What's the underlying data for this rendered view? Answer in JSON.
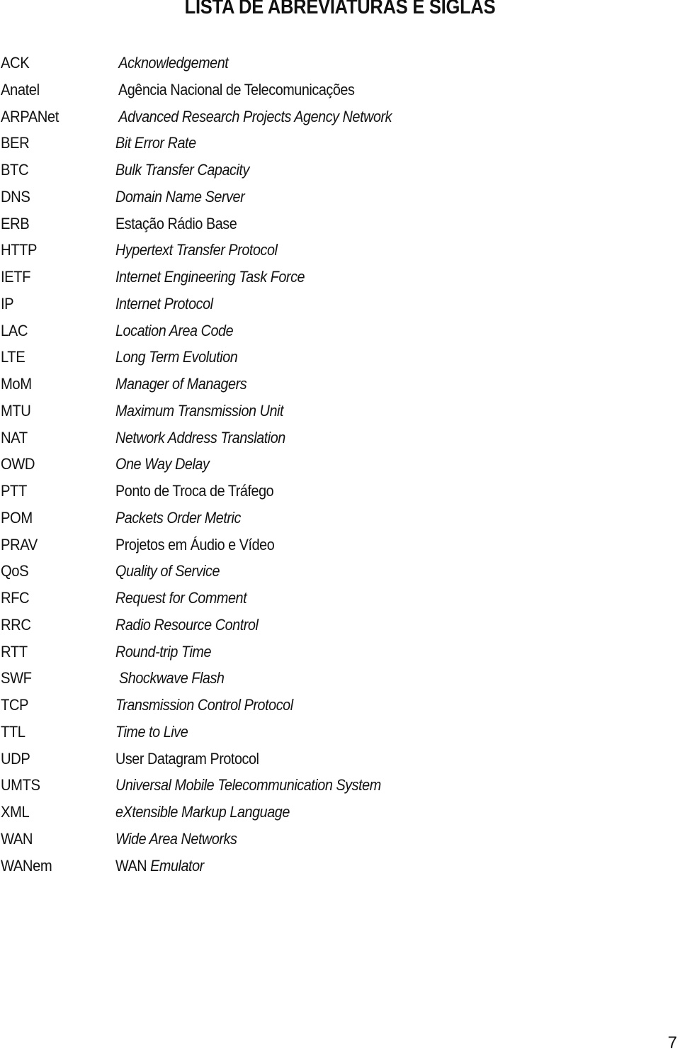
{
  "document": {
    "title": "LISTA DE ABREVIATURAS E SIGLAS",
    "page_number": "7",
    "entries": [
      {
        "abbr": "ACK",
        "parts": [
          {
            "text": " Acknowledgement",
            "italic": true
          }
        ]
      },
      {
        "abbr": "Anatel",
        "parts": [
          {
            "text": " Agência Nacional de Telecomunicações",
            "italic": false
          }
        ]
      },
      {
        "abbr": "ARPANet",
        "parts": [
          {
            "text": " Advanced Research Projects Agency Network",
            "italic": true
          }
        ]
      },
      {
        "abbr": "BER",
        "parts": [
          {
            "text": "Bit Error Rate",
            "italic": true
          }
        ]
      },
      {
        "abbr": "BTC",
        "parts": [
          {
            "text": "Bulk Transfer Capacity",
            "italic": true
          }
        ]
      },
      {
        "abbr": "DNS",
        "parts": [
          {
            "text": "Domain Name Server",
            "italic": true
          }
        ]
      },
      {
        "abbr": "ERB",
        "parts": [
          {
            "text": "Estação Rádio Base",
            "italic": false
          }
        ]
      },
      {
        "abbr": "HTTP",
        "parts": [
          {
            "text": "Hypertext Transfer Protocol",
            "italic": true
          }
        ]
      },
      {
        "abbr": "IETF",
        "parts": [
          {
            "text": "Internet Engineering Task Force",
            "italic": true
          }
        ]
      },
      {
        "abbr": "IP",
        "parts": [
          {
            "text": "Internet Protocol",
            "italic": true
          }
        ]
      },
      {
        "abbr": "LAC",
        "parts": [
          {
            "text": "Location Area Code",
            "italic": true
          }
        ]
      },
      {
        "abbr": "LTE",
        "parts": [
          {
            "text": "Long Term Evolution",
            "italic": true
          }
        ]
      },
      {
        "abbr": "MoM",
        "parts": [
          {
            "text": "Manager of Managers",
            "italic": true
          }
        ]
      },
      {
        "abbr": "MTU",
        "parts": [
          {
            "text": "Maximum Transmission Unit",
            "italic": true
          }
        ]
      },
      {
        "abbr": "NAT",
        "parts": [
          {
            "text": "Network Address Translation",
            "italic": true
          }
        ]
      },
      {
        "abbr": "OWD",
        "parts": [
          {
            "text": "One Way Delay",
            "italic": true
          }
        ]
      },
      {
        "abbr": "PTT",
        "parts": [
          {
            "text": "Ponto de Troca de Tráfego",
            "italic": false
          }
        ]
      },
      {
        "abbr": "POM",
        "parts": [
          {
            "text": "Packets Order Metric",
            "italic": true
          }
        ]
      },
      {
        "abbr": "PRAV",
        "parts": [
          {
            "text": "Projetos em Áudio e Vídeo",
            "italic": false
          }
        ]
      },
      {
        "abbr": "QoS",
        "parts": [
          {
            "text": "Quality of Service",
            "italic": true
          }
        ]
      },
      {
        "abbr": "RFC",
        "parts": [
          {
            "text": "Request for Comment",
            "italic": true
          }
        ]
      },
      {
        "abbr": "RRC",
        "parts": [
          {
            "text": "Radio Resource Control",
            "italic": true
          }
        ]
      },
      {
        "abbr": "RTT",
        "parts": [
          {
            "text": "Round-trip Time",
            "italic": true
          }
        ]
      },
      {
        "abbr": "SWF",
        "parts": [
          {
            "text": " Shockwave Flash",
            "italic": true
          }
        ]
      },
      {
        "abbr": "TCP",
        "parts": [
          {
            "text": "Transmission Control Protocol",
            "italic": true
          }
        ]
      },
      {
        "abbr": "TTL",
        "parts": [
          {
            "text": "Time to Live",
            "italic": true
          }
        ]
      },
      {
        "abbr": "UDP",
        "parts": [
          {
            "text": "User Datagram Protocol",
            "italic": false
          }
        ]
      },
      {
        "abbr": "UMTS",
        "parts": [
          {
            "text": "Universal Mobile Telecommunication System",
            "italic": true
          }
        ]
      },
      {
        "abbr": "XML",
        "parts": [
          {
            "text": "eXtensible Markup Language",
            "italic": true
          }
        ]
      },
      {
        "abbr": "WAN",
        "parts": [
          {
            "text": "Wide Area Networks",
            "italic": true
          }
        ]
      },
      {
        "abbr": "WANem",
        "parts": [
          {
            "text": "WAN ",
            "italic": false
          },
          {
            "text": "Emulator",
            "italic": true
          }
        ]
      }
    ]
  }
}
